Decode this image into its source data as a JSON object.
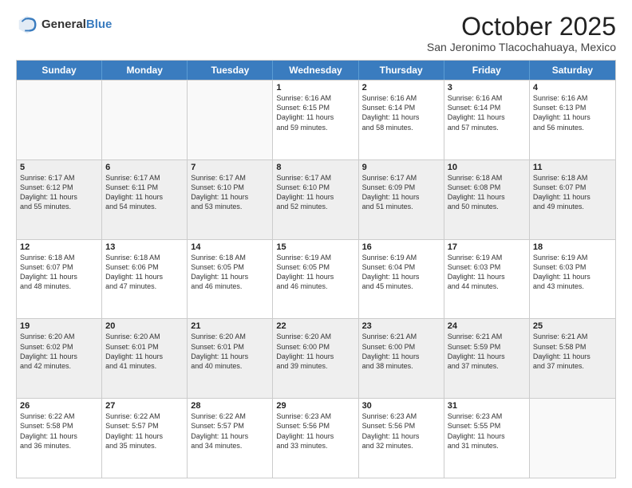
{
  "header": {
    "logo_line1": "General",
    "logo_line2": "Blue",
    "month": "October 2025",
    "location": "San Jeronimo Tlacochahuaya, Mexico"
  },
  "days_of_week": [
    "Sunday",
    "Monday",
    "Tuesday",
    "Wednesday",
    "Thursday",
    "Friday",
    "Saturday"
  ],
  "weeks": [
    [
      {
        "day": "",
        "info": ""
      },
      {
        "day": "",
        "info": ""
      },
      {
        "day": "",
        "info": ""
      },
      {
        "day": "1",
        "info": "Sunrise: 6:16 AM\nSunset: 6:15 PM\nDaylight: 11 hours\nand 59 minutes."
      },
      {
        "day": "2",
        "info": "Sunrise: 6:16 AM\nSunset: 6:14 PM\nDaylight: 11 hours\nand 58 minutes."
      },
      {
        "day": "3",
        "info": "Sunrise: 6:16 AM\nSunset: 6:14 PM\nDaylight: 11 hours\nand 57 minutes."
      },
      {
        "day": "4",
        "info": "Sunrise: 6:16 AM\nSunset: 6:13 PM\nDaylight: 11 hours\nand 56 minutes."
      }
    ],
    [
      {
        "day": "5",
        "info": "Sunrise: 6:17 AM\nSunset: 6:12 PM\nDaylight: 11 hours\nand 55 minutes."
      },
      {
        "day": "6",
        "info": "Sunrise: 6:17 AM\nSunset: 6:11 PM\nDaylight: 11 hours\nand 54 minutes."
      },
      {
        "day": "7",
        "info": "Sunrise: 6:17 AM\nSunset: 6:10 PM\nDaylight: 11 hours\nand 53 minutes."
      },
      {
        "day": "8",
        "info": "Sunrise: 6:17 AM\nSunset: 6:10 PM\nDaylight: 11 hours\nand 52 minutes."
      },
      {
        "day": "9",
        "info": "Sunrise: 6:17 AM\nSunset: 6:09 PM\nDaylight: 11 hours\nand 51 minutes."
      },
      {
        "day": "10",
        "info": "Sunrise: 6:18 AM\nSunset: 6:08 PM\nDaylight: 11 hours\nand 50 minutes."
      },
      {
        "day": "11",
        "info": "Sunrise: 6:18 AM\nSunset: 6:07 PM\nDaylight: 11 hours\nand 49 minutes."
      }
    ],
    [
      {
        "day": "12",
        "info": "Sunrise: 6:18 AM\nSunset: 6:07 PM\nDaylight: 11 hours\nand 48 minutes."
      },
      {
        "day": "13",
        "info": "Sunrise: 6:18 AM\nSunset: 6:06 PM\nDaylight: 11 hours\nand 47 minutes."
      },
      {
        "day": "14",
        "info": "Sunrise: 6:18 AM\nSunset: 6:05 PM\nDaylight: 11 hours\nand 46 minutes."
      },
      {
        "day": "15",
        "info": "Sunrise: 6:19 AM\nSunset: 6:05 PM\nDaylight: 11 hours\nand 46 minutes."
      },
      {
        "day": "16",
        "info": "Sunrise: 6:19 AM\nSunset: 6:04 PM\nDaylight: 11 hours\nand 45 minutes."
      },
      {
        "day": "17",
        "info": "Sunrise: 6:19 AM\nSunset: 6:03 PM\nDaylight: 11 hours\nand 44 minutes."
      },
      {
        "day": "18",
        "info": "Sunrise: 6:19 AM\nSunset: 6:03 PM\nDaylight: 11 hours\nand 43 minutes."
      }
    ],
    [
      {
        "day": "19",
        "info": "Sunrise: 6:20 AM\nSunset: 6:02 PM\nDaylight: 11 hours\nand 42 minutes."
      },
      {
        "day": "20",
        "info": "Sunrise: 6:20 AM\nSunset: 6:01 PM\nDaylight: 11 hours\nand 41 minutes."
      },
      {
        "day": "21",
        "info": "Sunrise: 6:20 AM\nSunset: 6:01 PM\nDaylight: 11 hours\nand 40 minutes."
      },
      {
        "day": "22",
        "info": "Sunrise: 6:20 AM\nSunset: 6:00 PM\nDaylight: 11 hours\nand 39 minutes."
      },
      {
        "day": "23",
        "info": "Sunrise: 6:21 AM\nSunset: 6:00 PM\nDaylight: 11 hours\nand 38 minutes."
      },
      {
        "day": "24",
        "info": "Sunrise: 6:21 AM\nSunset: 5:59 PM\nDaylight: 11 hours\nand 37 minutes."
      },
      {
        "day": "25",
        "info": "Sunrise: 6:21 AM\nSunset: 5:58 PM\nDaylight: 11 hours\nand 37 minutes."
      }
    ],
    [
      {
        "day": "26",
        "info": "Sunrise: 6:22 AM\nSunset: 5:58 PM\nDaylight: 11 hours\nand 36 minutes."
      },
      {
        "day": "27",
        "info": "Sunrise: 6:22 AM\nSunset: 5:57 PM\nDaylight: 11 hours\nand 35 minutes."
      },
      {
        "day": "28",
        "info": "Sunrise: 6:22 AM\nSunset: 5:57 PM\nDaylight: 11 hours\nand 34 minutes."
      },
      {
        "day": "29",
        "info": "Sunrise: 6:23 AM\nSunset: 5:56 PM\nDaylight: 11 hours\nand 33 minutes."
      },
      {
        "day": "30",
        "info": "Sunrise: 6:23 AM\nSunset: 5:56 PM\nDaylight: 11 hours\nand 32 minutes."
      },
      {
        "day": "31",
        "info": "Sunrise: 6:23 AM\nSunset: 5:55 PM\nDaylight: 11 hours\nand 31 minutes."
      },
      {
        "day": "",
        "info": ""
      }
    ]
  ]
}
